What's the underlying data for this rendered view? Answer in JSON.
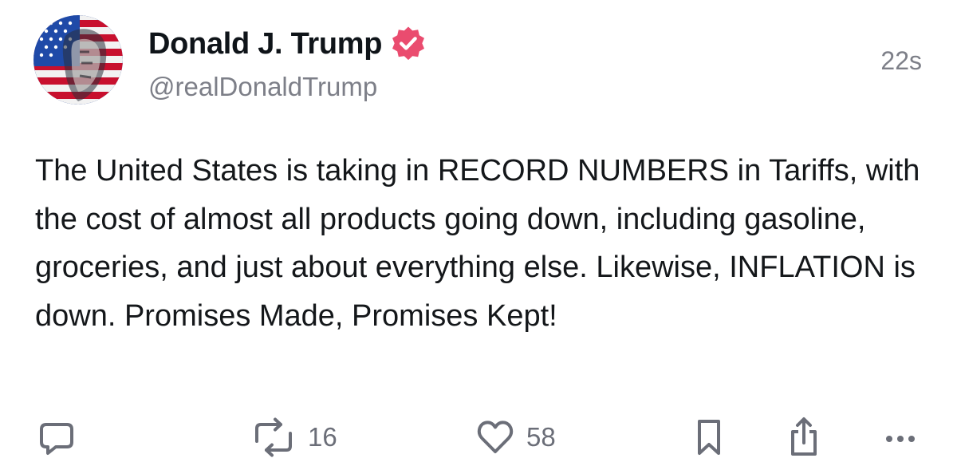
{
  "author": {
    "display_name": "Donald J. Trump",
    "handle": "@realDonaldTrump",
    "verified": true,
    "verified_color": "#ea4c6f",
    "avatar_icon": "stars-and-stripes-portrait"
  },
  "timestamp": "22s",
  "post": {
    "text": "The United States is taking in RECORD NUMBERS in Tariffs, with the cost of almost all products going down, including gasoline, groceries, and just about everything else. Likewise, INFLATION is down. Promises Made, Promises Kept!"
  },
  "actions": {
    "reply": {
      "icon": "speech-bubble-icon"
    },
    "repost": {
      "icon": "repost-icon",
      "count": "16"
    },
    "like": {
      "icon": "heart-icon",
      "count": "58"
    },
    "bookmark": {
      "icon": "bookmark-icon"
    },
    "share": {
      "icon": "share-icon"
    },
    "more": {
      "icon": "more-icon"
    }
  },
  "colors": {
    "text": "#14171a",
    "muted": "#7d7f88",
    "icon": "#6b6e78"
  }
}
